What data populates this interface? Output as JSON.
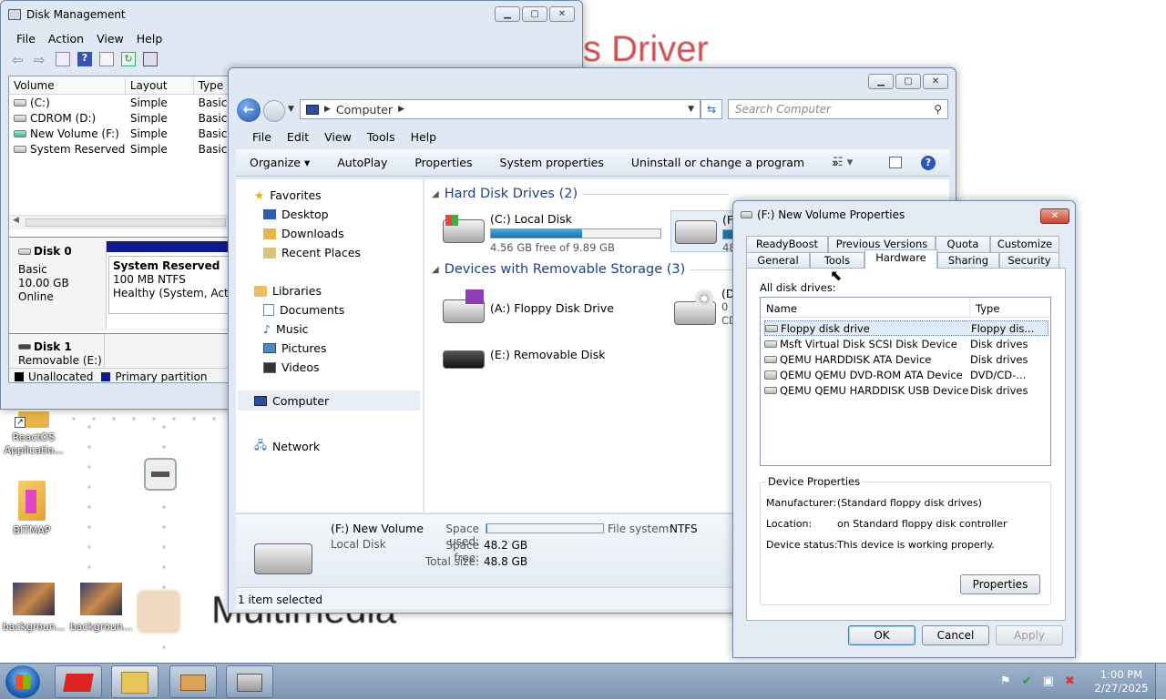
{
  "desktop": {
    "bg_texts": {
      "driver": "s Driver",
      "multimedia": "Multimedia"
    },
    "icons": [
      {
        "label": "ReactOS Applicatio..."
      },
      {
        "label": "BITMAP"
      },
      {
        "label": "backgroun..."
      },
      {
        "label": "backgroun..."
      }
    ]
  },
  "disk_management": {
    "title": "Disk Management",
    "menu": [
      "File",
      "Action",
      "View",
      "Help"
    ],
    "columns": [
      "Volume",
      "Layout",
      "Type"
    ],
    "volumes": [
      {
        "name": "(C:)",
        "layout": "Simple",
        "type": "Basic"
      },
      {
        "name": "CDROM (D:)",
        "layout": "Simple",
        "type": "Basic"
      },
      {
        "name": "New Volume (F:)",
        "layout": "Simple",
        "type": "Basic"
      },
      {
        "name": "System Reserved",
        "layout": "Simple",
        "type": "Basic"
      }
    ],
    "disk0": {
      "name": "Disk 0",
      "kind": "Basic",
      "size": "10.00 GB",
      "status": "Online",
      "part_name": "System Reserved",
      "part_size": "100 MB NTFS",
      "part_status": "Healthy (System, Active"
    },
    "disk1": {
      "name": "Disk 1",
      "kind": "Removable (E:)"
    },
    "legend": {
      "unallocated": "Unallocated",
      "primary": "Primary partition"
    }
  },
  "explorer": {
    "address": "Computer",
    "search_placeholder": "Search Computer",
    "menu": [
      "File",
      "Edit",
      "View",
      "Tools",
      "Help"
    ],
    "commands": [
      "Organize",
      "AutoPlay",
      "Properties",
      "System properties",
      "Uninstall or change a program"
    ],
    "nav": {
      "favorites": "Favorites",
      "desktop": "Desktop",
      "downloads": "Downloads",
      "recent": "Recent Places",
      "libraries": "Libraries",
      "documents": "Documents",
      "music": "Music",
      "pictures": "Pictures",
      "videos": "Videos",
      "computer": "Computer",
      "network": "Network"
    },
    "groups": {
      "hdd": "Hard Disk Drives (2)",
      "removable": "Devices with Removable Storage (3)"
    },
    "drives": {
      "c_name": "(C:) Local Disk",
      "c_free": "4.56 GB free of 9.89 GB",
      "c_used_fraction": 0.54,
      "f_partial": "(F:",
      "f_free_partial": "48",
      "a_name": "(A:) Floppy Disk Drive",
      "d_partial": "(D",
      "d_line2": "0 b",
      "d_line3": "CD",
      "e_name": "(E:) Removable Disk"
    },
    "details": {
      "name": "(F:) New Volume",
      "kind": "Local Disk",
      "space_used_label": "Space used:",
      "space_used_fraction": 0.01,
      "fs_label": "File system:",
      "fs_value": "NTFS",
      "free_label": "Space free:",
      "free_value": "48.2 GB",
      "total_label": "Total size:",
      "total_value": "48.8 GB"
    },
    "status": "1 item selected"
  },
  "properties": {
    "title": "(F:) New Volume Properties",
    "tabs_row1": [
      "ReadyBoost",
      "Previous Versions",
      "Quota",
      "Customize"
    ],
    "tabs_row2": [
      "General",
      "Tools",
      "Hardware",
      "Sharing",
      "Security"
    ],
    "all_disk_drives": "All disk drives:",
    "list_columns": [
      "Name",
      "Type"
    ],
    "drives": [
      {
        "name": "Floppy disk drive",
        "type": "Floppy dis..."
      },
      {
        "name": "Msft Virtual Disk SCSI Disk Device",
        "type": "Disk drives"
      },
      {
        "name": "QEMU HARDDISK ATA Device",
        "type": "Disk drives"
      },
      {
        "name": "QEMU QEMU DVD-ROM ATA Device",
        "type": "DVD/CD-..."
      },
      {
        "name": "QEMU QEMU HARDDISK USB Device",
        "type": "Disk drives"
      }
    ],
    "device_props": {
      "group": "Device Properties",
      "manufacturer_label": "Manufacturer:",
      "manufacturer": "(Standard floppy disk drives)",
      "location_label": "Location:",
      "location": "on Standard floppy disk controller",
      "status_label": "Device status:",
      "status": "This device is working properly."
    },
    "buttons": {
      "properties": "Properties",
      "ok": "OK",
      "cancel": "Cancel",
      "apply": "Apply"
    }
  },
  "taskbar": {
    "time": "1:00 PM",
    "date": "2/27/2025"
  }
}
